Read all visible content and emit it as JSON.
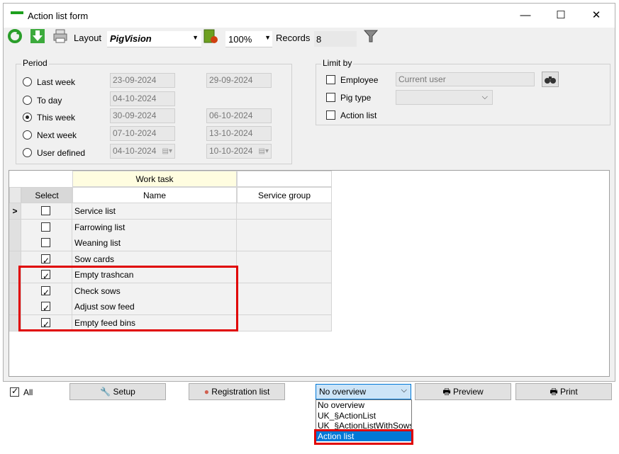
{
  "window": {
    "title": "Action list form",
    "min": "—",
    "max": "☐",
    "close": "✕"
  },
  "toolbar": {
    "layout_label": "Layout",
    "layout_value": "PigVision",
    "zoom": "100%",
    "records_label": "Records",
    "records_value": "8"
  },
  "period": {
    "title": "Period",
    "rows": [
      {
        "label": "Last week",
        "from": "23-09-2024",
        "to": "29-09-2024",
        "selected": false
      },
      {
        "label": "To day",
        "from": "04-10-2024",
        "to": "",
        "selected": false
      },
      {
        "label": "This week",
        "from": "30-09-2024",
        "to": "06-10-2024",
        "selected": true
      },
      {
        "label": "Next week",
        "from": "07-10-2024",
        "to": "13-10-2024",
        "selected": false
      },
      {
        "label": "User defined",
        "from": "04-10-2024",
        "to": "10-10-2024",
        "selected": false
      }
    ]
  },
  "limit": {
    "title": "Limit by",
    "employee_label": "Employee",
    "employee_value": "Current user",
    "pigtype_label": "Pig type",
    "actionlist_label": "Action list"
  },
  "grid": {
    "band_header": "Work task",
    "select_header": "Select",
    "name_header": "Name",
    "service_header": "Service group",
    "current_marker": ">",
    "rows": [
      {
        "name": "Service list",
        "checked": false
      },
      {
        "name": "Farrowing list",
        "checked": false
      },
      {
        "name": "Weaning list",
        "checked": false
      },
      {
        "name": "Sow cards",
        "checked": true
      },
      {
        "name": "Empty trashcan",
        "checked": true
      },
      {
        "name": "Check sows",
        "checked": true
      },
      {
        "name": "Adjust sow feed",
        "checked": true
      },
      {
        "name": "Empty feed bins",
        "checked": true
      }
    ]
  },
  "bottom": {
    "all_label": "All",
    "setup_label": "Setup",
    "registration_label": "Registration list",
    "overview_value": "No overview",
    "preview_label": "Preview",
    "print_label": "Print"
  },
  "dropdown": {
    "options": [
      "No overview",
      "UK_§ActionList",
      "UK_§ActionListWithSows",
      "Action list"
    ],
    "selected_index": 3
  },
  "colors": {
    "highlight": "#e00000",
    "accent": "#0078d7",
    "band": "#fffde0"
  }
}
